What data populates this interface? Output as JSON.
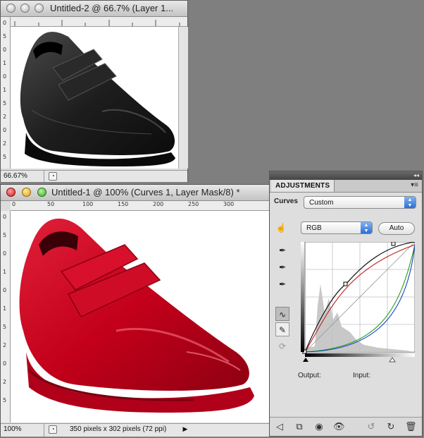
{
  "window2": {
    "title": "Untitled-2 @ 66.7% (Layer 1...",
    "zoom": "66.67%",
    "ruler_left_labels": [
      "0",
      "5",
      "0",
      "1",
      "0",
      "1",
      "5",
      "2",
      "0",
      "2",
      "5"
    ]
  },
  "window1": {
    "title": "Untitled-1 @ 100% (Curves 1, Layer Mask/8) *",
    "zoom": "100%",
    "size_info": "350 pixels x 302 pixels (72 ppi)",
    "ruler_top_labels": [
      "0",
      "50",
      "100",
      "150",
      "200",
      "250",
      "300"
    ],
    "ruler_left_labels": [
      "0",
      "5",
      "0",
      "1",
      "0",
      "1",
      "5",
      "2",
      "0",
      "2",
      "5"
    ]
  },
  "adjustments": {
    "tab_label": "ADJUSTMENTS",
    "curves_label": "Curves",
    "preset": "Custom",
    "channel": "RGB",
    "auto_label": "Auto",
    "output_label": "Output:",
    "input_label": "Input:"
  },
  "colors": {
    "shoe_red": "#c8001e",
    "shoe_black": "#1c1c1c"
  },
  "icons": [
    "finger-adjust-icon",
    "eyedropper-black-icon",
    "eyedropper-gray-icon",
    "eyedropper-white-icon",
    "curve-point-icon",
    "pencil-icon",
    "smooth-icon",
    "back-arrow-icon",
    "clip-layer-icon",
    "visibility-toggle-icon",
    "eye-icon",
    "previous-state-icon",
    "reset-icon",
    "trash-icon"
  ]
}
